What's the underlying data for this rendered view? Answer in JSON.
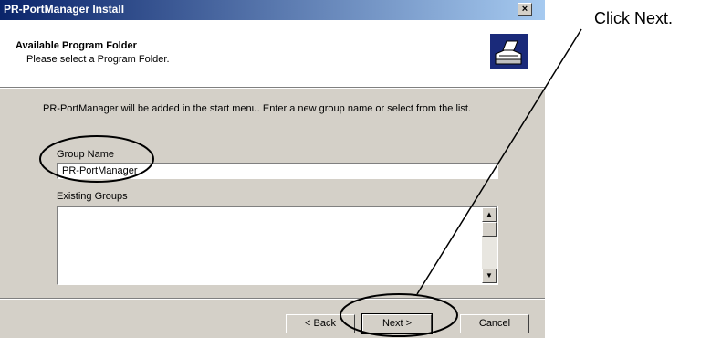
{
  "window": {
    "title": "PR-PortManager Install",
    "close_glyph": "×"
  },
  "header": {
    "title": "Available Program Folder",
    "subtitle": "Please select a Program Folder.",
    "icon": "computer-setup-icon"
  },
  "body": {
    "description": "PR-PortManager will be added in the start menu. Enter a new group name  or select from the list.",
    "group_name_label": "Group Name",
    "group_name_value": "PR-PortManager",
    "existing_groups_label": "Existing Groups",
    "existing_groups": []
  },
  "buttons": {
    "back": "< Back",
    "next": "Next >",
    "cancel": "Cancel"
  },
  "annotation": {
    "text": "Click Next."
  },
  "colors": {
    "titlebar_start": "#0a246a",
    "titlebar_end": "#a6caf0",
    "dialog_face": "#d4d0c8"
  }
}
